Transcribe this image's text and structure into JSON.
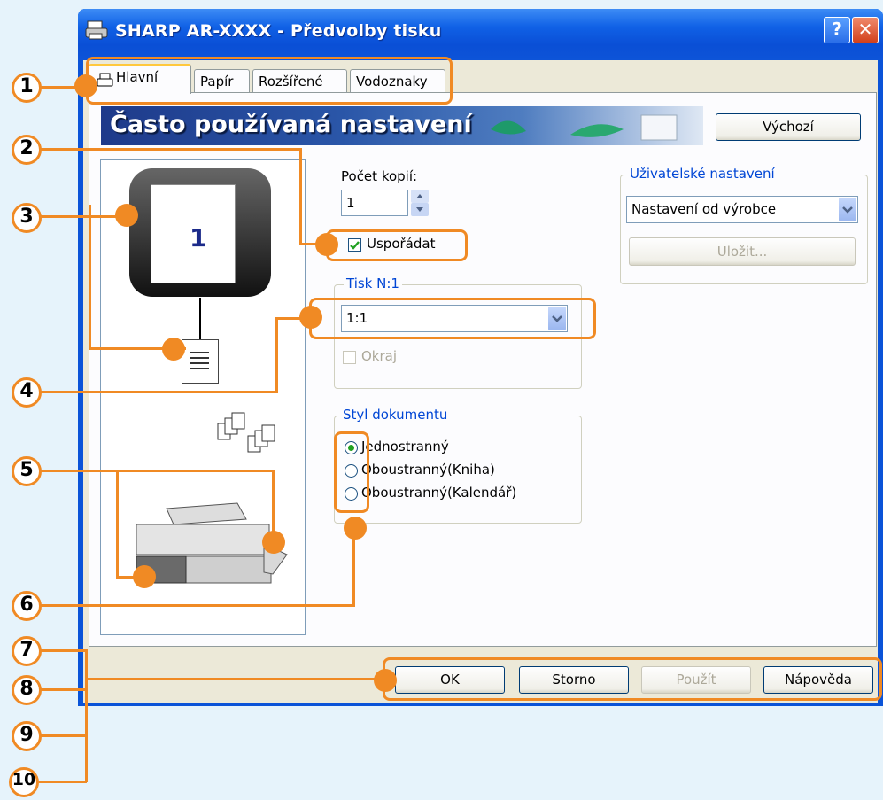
{
  "window": {
    "title": "SHARP AR-XXXX - Předvolby tisku",
    "help_glyph": "?",
    "close_glyph": "✕"
  },
  "tabs": [
    {
      "label": "Hlavní",
      "active": true
    },
    {
      "label": "Papír",
      "active": false
    },
    {
      "label": "Rozšířené",
      "active": false
    },
    {
      "label": "Vodoznaky",
      "active": false
    }
  ],
  "banner": {
    "title": "Často používaná nastavení"
  },
  "buttons": {
    "default": "Výchozí",
    "save": "Uložit...",
    "ok": "OK",
    "cancel": "Storno",
    "apply": "Použít",
    "help": "Nápověda"
  },
  "preview": {
    "page_number": "1"
  },
  "copies": {
    "label": "Počet kopií:",
    "value": "1"
  },
  "collate": {
    "label": "Uspořádat",
    "checked": true
  },
  "user_settings": {
    "title": "Uživatelské nastavení",
    "selected": "Nastavení od výrobce"
  },
  "n_up": {
    "title": "Tisk N:1",
    "selected": "1:1",
    "border_label": "Okraj",
    "border_checked": false
  },
  "document_style": {
    "title": "Styl dokumentu",
    "options": [
      {
        "label": "Jednostranný",
        "selected": true
      },
      {
        "label": "Oboustranný(Kniha)",
        "selected": false
      },
      {
        "label": "Oboustranný(Kalendář)",
        "selected": false
      }
    ]
  },
  "callouts": [
    "1",
    "2",
    "3",
    "4",
    "5",
    "6",
    "7",
    "8",
    "9",
    "10"
  ],
  "colors": {
    "accent": "#f08a24",
    "titlebar": "#0a53d8",
    "dialog": "#ece9d8"
  }
}
